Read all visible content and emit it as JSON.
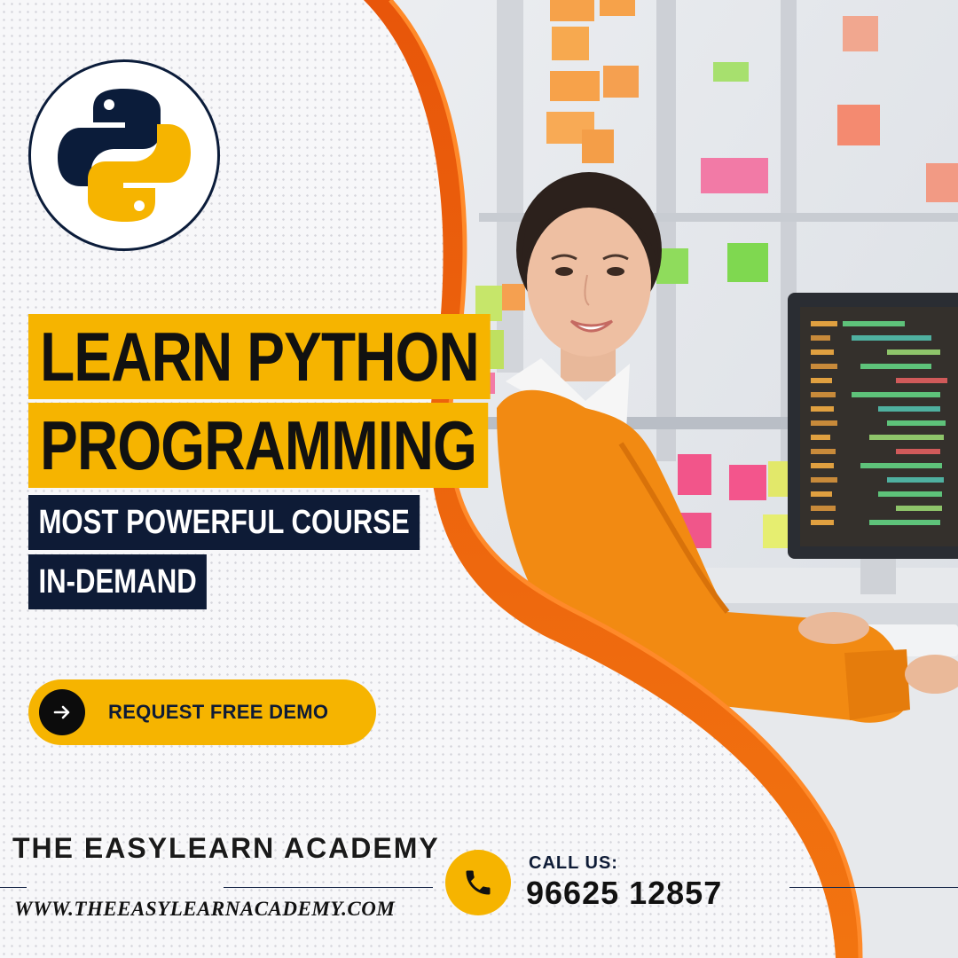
{
  "headline": {
    "line1": "LEARN PYTHON",
    "line2": "PROGRAMMING"
  },
  "subtitles": {
    "line1": "MOST POWERFUL COURSE",
    "line2": "IN-DEMAND"
  },
  "cta": {
    "label": "REQUEST FREE DEMO",
    "icon": "arrow-right-icon"
  },
  "footer": {
    "academy_name": "THE EASYLEARN ACADEMY",
    "website": "WWW.THEEASYLEARNACADEMY.COM",
    "call_label": "CALL US:",
    "phone_number": "96625 12857",
    "phone_icon": "phone-icon"
  },
  "logo": {
    "icon": "python-logo-icon"
  },
  "colors": {
    "accent": "#f6b400",
    "navy": "#0e1b36",
    "orange_wave": "#f0620e",
    "python_blue": "#0b1c3a",
    "python_yellow": "#f6b400",
    "sweater": "#f28a12"
  }
}
